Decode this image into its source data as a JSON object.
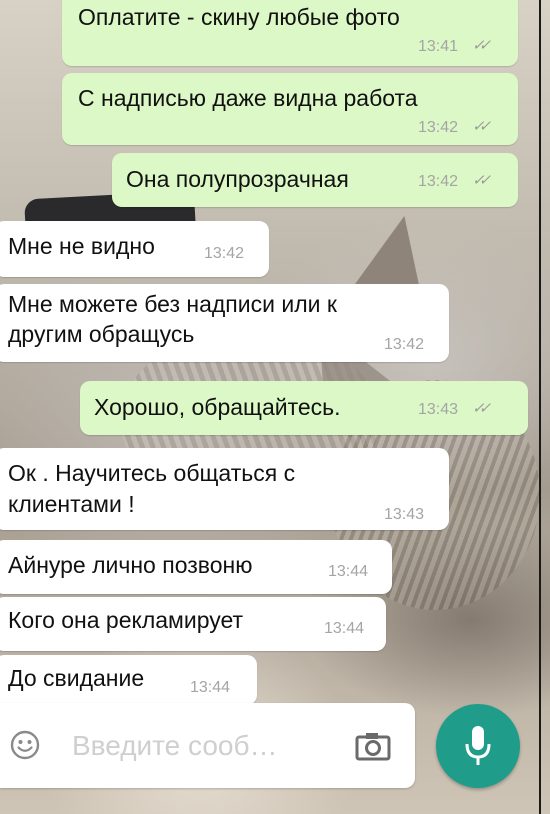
{
  "messages": [
    {
      "direction": "out",
      "text": [
        "Оплатите - скину любые фото"
      ],
      "time": "13:41",
      "read": true
    },
    {
      "direction": "out",
      "text": [
        "С надписью даже видна работа"
      ],
      "time": "13:42",
      "read": true
    },
    {
      "direction": "out",
      "text": [
        "Она полупрозрачная"
      ],
      "time": "13:42",
      "read": true
    },
    {
      "direction": "in",
      "text": [
        "Мне не видно"
      ],
      "time": "13:42"
    },
    {
      "direction": "in",
      "text": [
        "Мне можете без надписи или к",
        "другим обращусь"
      ],
      "time": "13:42"
    },
    {
      "direction": "out",
      "text": [
        "Хорошо, обращайтесь."
      ],
      "time": "13:43",
      "read": true
    },
    {
      "direction": "in",
      "text": [
        "Ок . Научитесь общаться с",
        "клиентами !"
      ],
      "time": "13:43"
    },
    {
      "direction": "in",
      "text": [
        "Айнуре лично позвоню"
      ],
      "time": "13:44"
    },
    {
      "direction": "in",
      "text": [
        "Кого она рекламирует"
      ],
      "time": "13:44"
    },
    {
      "direction": "in",
      "text": [
        "До свидание"
      ],
      "time": "13:44"
    }
  ],
  "composer": {
    "placeholder": "Введите сооб…",
    "emoji_icon": "smiley-icon",
    "camera_icon": "camera-icon",
    "mic_icon": "microphone-icon"
  },
  "colors": {
    "outgoing_bubble": "#dcf8c6",
    "incoming_bubble": "#ffffff",
    "mic_button": "#1f9d8a"
  }
}
